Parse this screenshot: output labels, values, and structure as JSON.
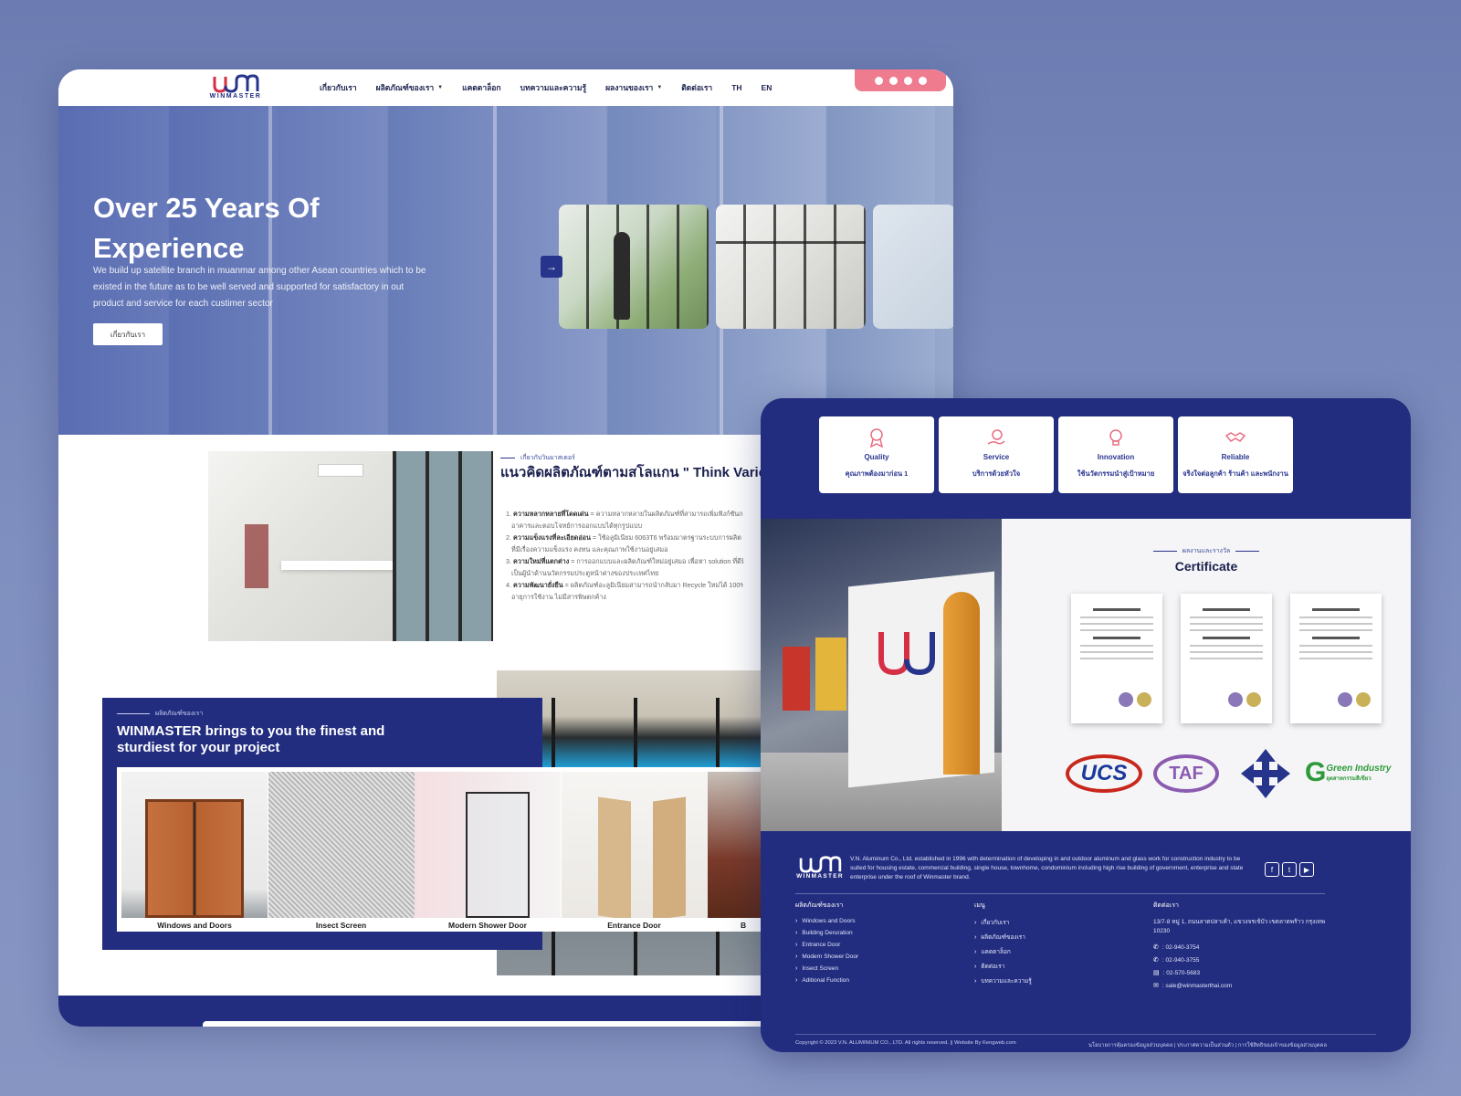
{
  "colors": {
    "brand_navy": "#222d80",
    "accent_pink": "#ef7b8f",
    "bg_blue": "#7f8fbf"
  },
  "site": {
    "logo_text": "WINMASTER",
    "nav": [
      {
        "label": "เกี่ยวกับเรา",
        "has_dropdown": false
      },
      {
        "label": "ผลิตภัณฑ์ของเรา",
        "has_dropdown": true
      },
      {
        "label": "แคตตาล็อก",
        "has_dropdown": false
      },
      {
        "label": "บทความและความรู้",
        "has_dropdown": false
      },
      {
        "label": "ผลงานของเรา",
        "has_dropdown": true
      },
      {
        "label": "ติดต่อเรา",
        "has_dropdown": false
      },
      {
        "label": "TH",
        "has_dropdown": false
      },
      {
        "label": "EN",
        "has_dropdown": false
      }
    ],
    "social_icons": [
      "facebook-icon",
      "instagram-icon",
      "youtube-icon",
      "pinterest-icon"
    ]
  },
  "hero": {
    "title": "Over 25 Years Of Experience",
    "subtitle": "We build up satellite branch in muanmar among other Asean countries which to be existed in the future as to be well served and supported for satisfactory in out product and service for each custimer sector",
    "button": "เกี่ยวกับเรา",
    "arrow": "→"
  },
  "philosophy": {
    "tag": "เกี่ยวกับวินมาสเตอร์",
    "title": "แนวคิดผลิตภัณฑ์ตามสโลแกน \" Think Variety Think Winmaster \"",
    "items": [
      {
        "bold": "ความหลากหลายที่โดดเด่น",
        "text": " = ความหลากหลายในผลิตภัณฑ์ที่สามารถเพิ่มฟังก์ชันการใช้งาน"
      },
      {
        "bold": "",
        "text": "อาคารและตอบโจทย์การออกแบบได้ทุกรูปแบบ"
      },
      {
        "bold": "ความแข็งแรงที่ละเอียดอ่อน",
        "text": " = ใช้อลูมิเนียม 6063T6 พร้อมมาตรฐานระบบการผลิต"
      },
      {
        "bold": "",
        "text": "ที่มีเรื่องความแข็งแรง คงทน และคุณภาพใช้งานอยู่เสมอ"
      },
      {
        "bold": "ความใหม่ที่แตกต่าง",
        "text": " = การออกแบบและผลิตภัณฑ์ใหม่อยู่เสมอ เพื่อหา solution ที่ดีที่สุด"
      },
      {
        "bold": "",
        "text": "เป็นผู้นำด้านนวัตกรรมประตูหน้าต่างของประเทศไทย"
      },
      {
        "bold": "ความพัฒนายั่งยืน",
        "text": " = ผลิตภัณฑ์อะลูมิเนียมสามารถนำกลับมา Recycle ใหม่ได้ 100%"
      },
      {
        "bold": "",
        "text": "อายุการใช้งาน ไม่มีสารพิษตกค้าง"
      }
    ]
  },
  "products": {
    "tag": "ผลิตภัณฑ์ของเรา",
    "title": "WINMASTER brings to you the finest and sturdiest for your project",
    "items": [
      "Windows and Doors",
      "Insect Screen",
      "Modern Shower Door",
      "Entrance Door",
      "B"
    ]
  },
  "features": [
    {
      "title": "Quality",
      "sub": "คุณภาพต้องมาก่อน 1",
      "icon": "award-icon"
    },
    {
      "title": "Service",
      "sub": "บริการด้วยหัวใจ",
      "icon": "service-hand-icon"
    },
    {
      "title": "Innovation",
      "sub": "ใช้นวัตกรรมนำสู่เป้าหมาย",
      "icon": "lightbulb-icon"
    },
    {
      "title": "Reliable",
      "sub": "จริงใจต่อลูกค้า ร้านค้า และพนักงาน",
      "icon": "handshake-icon"
    }
  ],
  "certificate": {
    "tag": "ผลงานและรางวัล",
    "title": "Certificate",
    "logos": [
      "UCS",
      "TAF",
      "Green Industry"
    ],
    "green_sub": "อุตสาหกรรมสีเขียว"
  },
  "footer": {
    "logo_text": "WINMASTER",
    "description": "V.N. Aluminum Co., Ltd. established in 1996 with determination of developing in and outdoor aluminum and glass work for construction industry to be suited for housing estate, commercial building, single house, townhome, condominium including high rise building of government, enterprise and state enterprise under the roof of Winmaster brand.",
    "social": [
      "f",
      "t",
      "▶"
    ],
    "col_products": {
      "heading": "ผลิตภัณฑ์ของเรา",
      "items": [
        "Windows and Doors",
        "Building Deruration",
        "Entrance Door",
        "Modern Shower Door",
        "Insect Screen",
        "Aditional Function"
      ]
    },
    "col_menu": {
      "heading": "เมนู",
      "items": [
        "เกี่ยวกับเรา",
        "ผลิตภัณฑ์ของเรา",
        "แคตตาล็อก",
        "ติดต่อเรา",
        "บทความและความรู้"
      ]
    },
    "col_contact": {
      "heading": "ติดต่อเรา",
      "address": "13/7-8 หมู่ 1, ถนนลาดปลาเค้า, แขวงจรเข้บัว เขตลาดพร้าว กรุงเทพ 10230",
      "phone1": ": 02-940-3754",
      "phone2": ": 02-940-3755",
      "fax": ": 02-570-5683",
      "email": ": sale@winmasterthai.com"
    },
    "copyright": "Copyright © 2023 V.N. ALUMINIUM CO., LTD. All rights reserved. || Website By Kengweb.com",
    "policy": "นโยบายการคุ้มครองข้อมูลส่วนบุคคล | ประกาศความเป็นส่วนตัว | การใช้สิทธิของเจ้าของข้อมูลส่วนบุคคล"
  }
}
